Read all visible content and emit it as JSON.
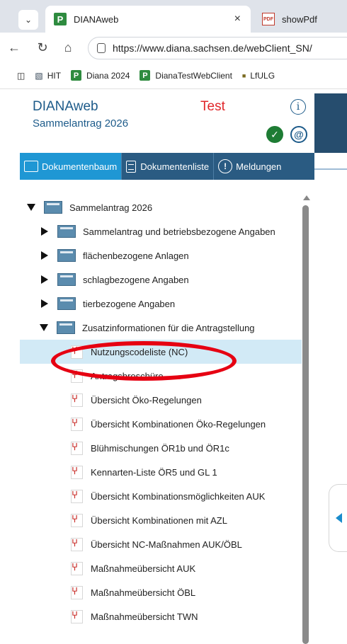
{
  "browser": {
    "tabs": [
      {
        "label": "DIANAweb",
        "favicon": "P",
        "active": true,
        "close_glyph": "×"
      },
      {
        "label": "showPdf",
        "favicon": "PDF",
        "active": false
      }
    ],
    "url": "https://www.diana.sachsen.de/webClient_SN/",
    "bookmarks": [
      {
        "label": "HIT",
        "icon": "hit-icon"
      },
      {
        "label": "Diana 2024",
        "icon": "P"
      },
      {
        "label": "DianaTestWebClient",
        "icon": "P"
      },
      {
        "label": "LfULG",
        "icon": "bookmark-icon"
      }
    ]
  },
  "app": {
    "title": "DIANAweb",
    "subtitle": "Sammelantrag 2026",
    "environment": "Test",
    "info_glyph": "i",
    "check_glyph": "✓",
    "at_glyph": "@",
    "environment_color": "#e0262a",
    "brand_color": "#1d5b8a"
  },
  "view_tabs": [
    {
      "label": "Dokumentenbaum",
      "selected": true,
      "icon": "folder-icon"
    },
    {
      "label": "Dokumentenliste",
      "selected": false,
      "icon": "list-icon"
    },
    {
      "label": "Meldungen",
      "selected": false,
      "icon": "alert-icon",
      "glyph": "!"
    }
  ],
  "tree": {
    "root": {
      "label": "Sammelantrag 2026",
      "expanded": true
    },
    "folders": [
      {
        "label": "Sammelantrag und betriebsbezogene Angaben",
        "expanded": false
      },
      {
        "label": "flächenbezogene Anlagen",
        "expanded": false
      },
      {
        "label": "schlagbezogene Angaben",
        "expanded": false
      },
      {
        "label": "tierbezogene Angaben",
        "expanded": false
      },
      {
        "label": "Zusatzinformationen für die Antragstellung",
        "expanded": true
      }
    ],
    "documents": [
      {
        "label": "Nutzungscodeliste (NC)",
        "selected": true
      },
      {
        "label": "Antragsbroschüre"
      },
      {
        "label": "Übersicht Öko-Regelungen"
      },
      {
        "label": "Übersicht Kombinationen Öko-Regelungen"
      },
      {
        "label": "Blühmischungen ÖR1b und ÖR1c"
      },
      {
        "label": "Kennarten-Liste ÖR5 und GL 1"
      },
      {
        "label": "Übersicht Kombinationsmöglichkeiten AUK"
      },
      {
        "label": "Übersicht Kombinationen mit AZL"
      },
      {
        "label": "Übersicht NC-Maßnahmen AUK/ÖBL"
      },
      {
        "label": "Maßnahmeübersicht AUK"
      },
      {
        "label": "Maßnahmeübersicht ÖBL"
      },
      {
        "label": "Maßnahmeübersicht TWN"
      }
    ]
  },
  "annotation": {
    "color": "#e60012",
    "shape": "ellipse",
    "target": "Nutzungscodeliste (NC)"
  }
}
